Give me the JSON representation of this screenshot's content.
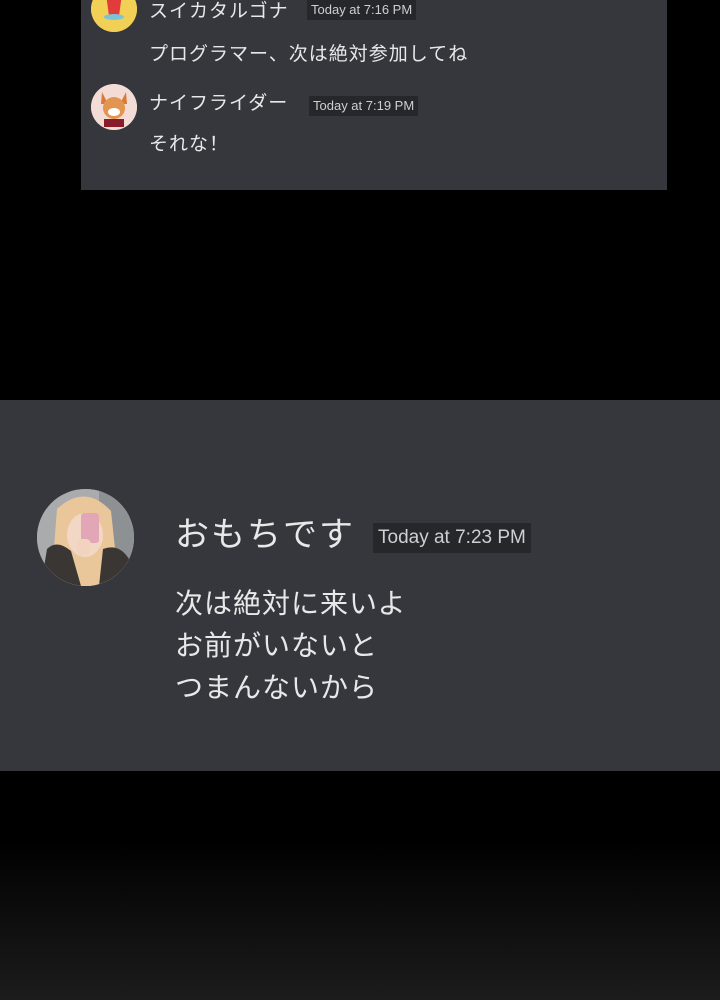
{
  "top_chat": {
    "messages": [
      {
        "username": "スイカタルゴナ",
        "timestamp": "Today at 7:16 PM",
        "text": "プログラマー、次は絶対参加してね"
      },
      {
        "username": "ナイフライダー",
        "timestamp": "Today at 7:19 PM",
        "text": "それな！"
      }
    ]
  },
  "bottom_chat": {
    "username": "おもちです",
    "timestamp": "Today at 7:23 PM",
    "lines": [
      "次は絶対に来いよ",
      "お前がいないと",
      "つまんないから"
    ]
  }
}
